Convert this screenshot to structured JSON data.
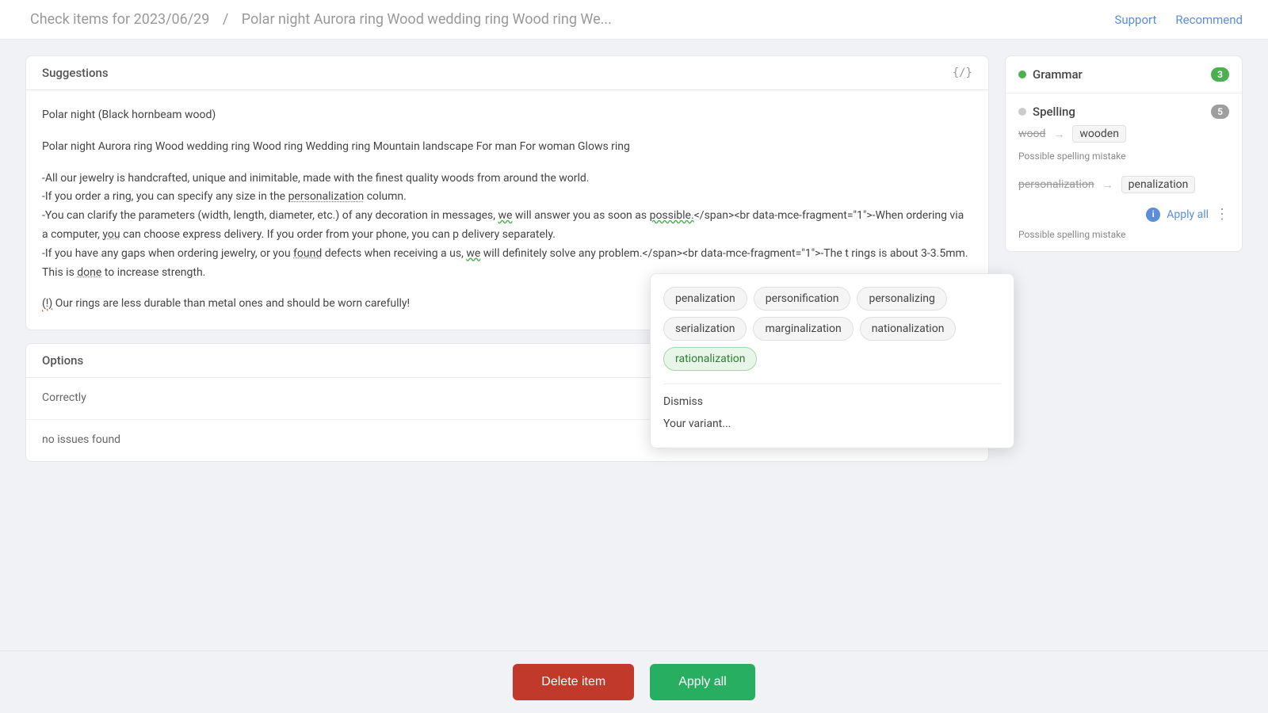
{
  "header": {
    "breadcrumb_part1": "Check items for 2023/06/29",
    "breadcrumb_separator": "/",
    "breadcrumb_part2": "Polar night Aurora ring Wood wedding ring Wood ring We...",
    "support_label": "Support",
    "recommend_label": "Recommend"
  },
  "suggestions_card": {
    "title": "Suggestions",
    "icon_label": "{/}",
    "paragraph1": "Polar night (Black hornbeam wood)",
    "paragraph2": "Polar night Aurora ring Wood wedding ring Wood ring Wedding ring Mountain landscape For man For woman Glows ring",
    "paragraph3_line1": "-All our jewelry is handcrafted, unique and inimitable, made with the finest quality woods from around the world.",
    "paragraph3_line2": "-If you order a ring, you can specify any size in the personalization column.",
    "paragraph3_line3": "-You can clarify the parameters (width, length, diameter, etc.) of any decoration in messages, we will answer you as soon as possible.</span><br data-mce-fragment=\"1\">-When ordering via a computer, you can choose express delivery. If you order from your phone, you can p delivery separately.",
    "paragraph3_line4": "-If you have any gaps when ordering jewelry, or you found defects when receiving a us, we will definitely solve any problem.</span><br data-mce-fragment=\"1\">-The t rings is about 3-3.5mm. This is done to increase strength.",
    "paragraph4": "(!) Our rings are less durable than metal ones and should be worn carefully!"
  },
  "options_card": {
    "title": "Options",
    "row1": "Correctly",
    "row2": "no issues found"
  },
  "sidebar": {
    "grammar_label": "Grammar",
    "grammar_count": "3",
    "spelling_label": "Spelling",
    "spelling_count": "5",
    "spelling_suggestion1_old": "wood",
    "spelling_suggestion1_new": "wooden",
    "spelling_possible1": "Possible spelling mistake",
    "spelling_suggestion2_old": "personalization",
    "spelling_suggestion2_new": "penalization",
    "spelling_possible2": "Possible spelling mistake",
    "apply_all_label": "Apply all"
  },
  "dropdown": {
    "chips": [
      {
        "label": "penalization",
        "highlighted": false
      },
      {
        "label": "personification",
        "highlighted": false
      },
      {
        "label": "personalizing",
        "highlighted": false
      },
      {
        "label": "serialization",
        "highlighted": false
      },
      {
        "label": "marginalization",
        "highlighted": false
      },
      {
        "label": "nationalization",
        "highlighted": false
      },
      {
        "label": "rationalization",
        "highlighted": true
      }
    ],
    "dismiss_label": "Dismiss",
    "your_variant_label": "Your variant..."
  },
  "bottom_bar": {
    "delete_label": "Delete item",
    "apply_label": "Apply all"
  }
}
